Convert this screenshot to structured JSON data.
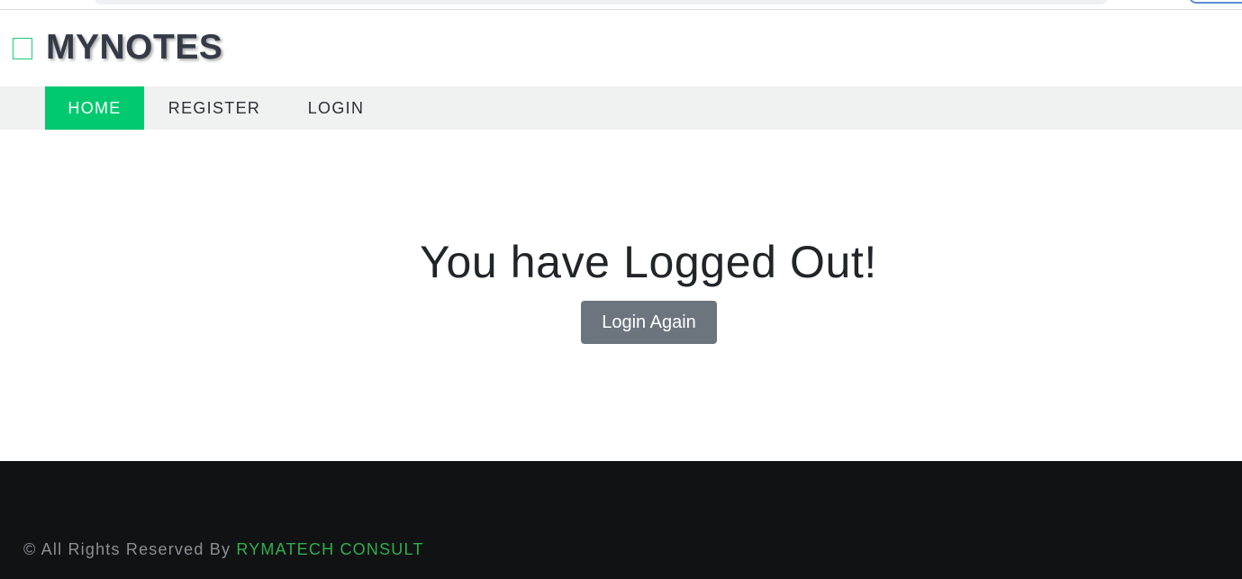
{
  "brand": {
    "icon": "notebook-icon",
    "title": "MYNOTES",
    "accent_color": "#00c96f"
  },
  "nav": {
    "items": [
      {
        "label": "HOME",
        "active": true
      },
      {
        "label": "REGISTER",
        "active": false
      },
      {
        "label": "LOGIN",
        "active": false
      }
    ]
  },
  "main": {
    "title": "You have Logged Out!",
    "button_label": "Login Again",
    "button_color": "#6c757d"
  },
  "footer": {
    "prefix": "© All Rights Reserved By ",
    "company": "RYMATECH CONSULT",
    "company_color": "#2fae4d",
    "background": "#111214"
  }
}
